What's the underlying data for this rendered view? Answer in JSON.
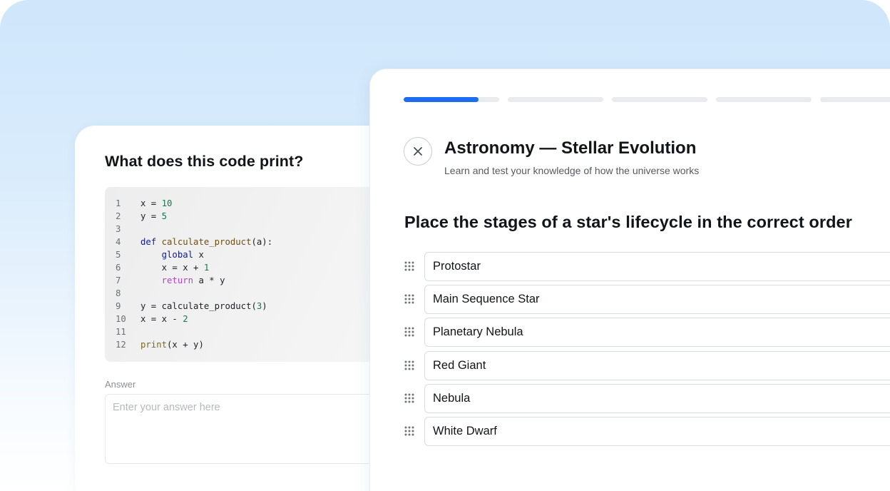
{
  "code_question": {
    "title": "What does this code print?",
    "lines": [
      {
        "n": "1",
        "tokens": [
          {
            "t": "x = ",
            "c": "lc"
          },
          {
            "t": "10",
            "c": "num"
          }
        ]
      },
      {
        "n": "2",
        "tokens": [
          {
            "t": "y = ",
            "c": "lc"
          },
          {
            "t": "5",
            "c": "num"
          }
        ]
      },
      {
        "n": "3",
        "tokens": []
      },
      {
        "n": "4",
        "tokens": [
          {
            "t": "def ",
            "c": "kw"
          },
          {
            "t": "calculate_product",
            "c": "fn"
          },
          {
            "t": "(a):",
            "c": "lc"
          }
        ]
      },
      {
        "n": "5",
        "tokens": [
          {
            "t": "    ",
            "c": "lc"
          },
          {
            "t": "global",
            "c": "kw"
          },
          {
            "t": " x",
            "c": "lc"
          }
        ]
      },
      {
        "n": "6",
        "tokens": [
          {
            "t": "    x = x + ",
            "c": "lc"
          },
          {
            "t": "1",
            "c": "num"
          }
        ]
      },
      {
        "n": "7",
        "tokens": [
          {
            "t": "    ",
            "c": "lc"
          },
          {
            "t": "return",
            "c": "kw2"
          },
          {
            "t": " a * y",
            "c": "lc"
          }
        ]
      },
      {
        "n": "8",
        "tokens": []
      },
      {
        "n": "9",
        "tokens": [
          {
            "t": "y = calculate_product(",
            "c": "lc"
          },
          {
            "t": "3",
            "c": "num"
          },
          {
            "t": ")",
            "c": "lc"
          }
        ]
      },
      {
        "n": "10",
        "tokens": [
          {
            "t": "x = x - ",
            "c": "lc"
          },
          {
            "t": "2",
            "c": "num"
          }
        ]
      },
      {
        "n": "11",
        "tokens": []
      },
      {
        "n": "12",
        "tokens": [
          {
            "t": "print",
            "c": "pn"
          },
          {
            "t": "(x + y)",
            "c": "lc"
          }
        ]
      }
    ],
    "answer_label": "Answer",
    "answer_placeholder": "Enter your answer here",
    "answer_value": ""
  },
  "quiz": {
    "progress_segments": [
      0.78,
      0,
      0,
      0,
      0
    ],
    "progress_color": "#1e6cf0",
    "close_icon": "close-icon",
    "title": "Astronomy — Stellar Evolution",
    "subtitle": "Learn and test your knowledge of how the universe works",
    "question": "Place the stages of a star's lifecycle in the correct order",
    "drag_icon": "drag-handle-icon",
    "options": [
      {
        "label": "Protostar"
      },
      {
        "label": "Main Sequence Star"
      },
      {
        "label": "Planetary Nebula"
      },
      {
        "label": "Red Giant"
      },
      {
        "label": "Nebula"
      },
      {
        "label": "White Dwarf"
      }
    ]
  }
}
